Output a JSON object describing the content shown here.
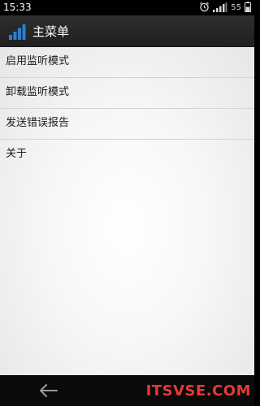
{
  "status_bar": {
    "time": "15:33",
    "battery_level": "55",
    "icons": [
      "alarm-icon",
      "signal-icon",
      "battery-icon"
    ]
  },
  "action_bar": {
    "title": "主菜单",
    "app_icon": "signal-bars-icon",
    "accent_color": "#2a7fd4"
  },
  "menu": {
    "items": [
      {
        "label": "启用监听模式"
      },
      {
        "label": "卸载监听模式"
      },
      {
        "label": "发送错误报告"
      },
      {
        "label": "关于"
      }
    ]
  },
  "nav_bar": {
    "back_icon": "back-arrow-icon",
    "watermark": "ITSVSE.COM"
  }
}
